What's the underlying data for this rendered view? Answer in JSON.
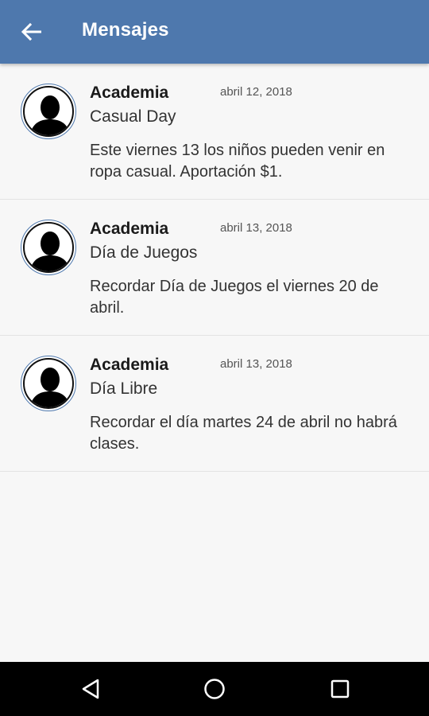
{
  "header": {
    "title": "Mensajes",
    "color": "#4e78ad"
  },
  "messages": [
    {
      "sender": "Academia",
      "date": "abril 12, 2018",
      "subject": "Casual Day",
      "body": "Este viernes 13 los niños pueden venir en ropa casual.  Aportación $1."
    },
    {
      "sender": "Academia",
      "date": "abril 13, 2018",
      "subject": "Día de Juegos",
      "body": "Recordar Día de Juegos el viernes 20 de abril."
    },
    {
      "sender": "Academia",
      "date": "abril 13, 2018",
      "subject": "Día Libre",
      "body": "Recordar el día martes 24 de abril no habrá clases."
    }
  ],
  "icons": {
    "back": "arrow-left-icon",
    "avatar": "person-silhouette-icon",
    "nav_back": "triangle-back-icon",
    "nav_home": "circle-home-icon",
    "nav_recents": "square-recents-icon"
  }
}
